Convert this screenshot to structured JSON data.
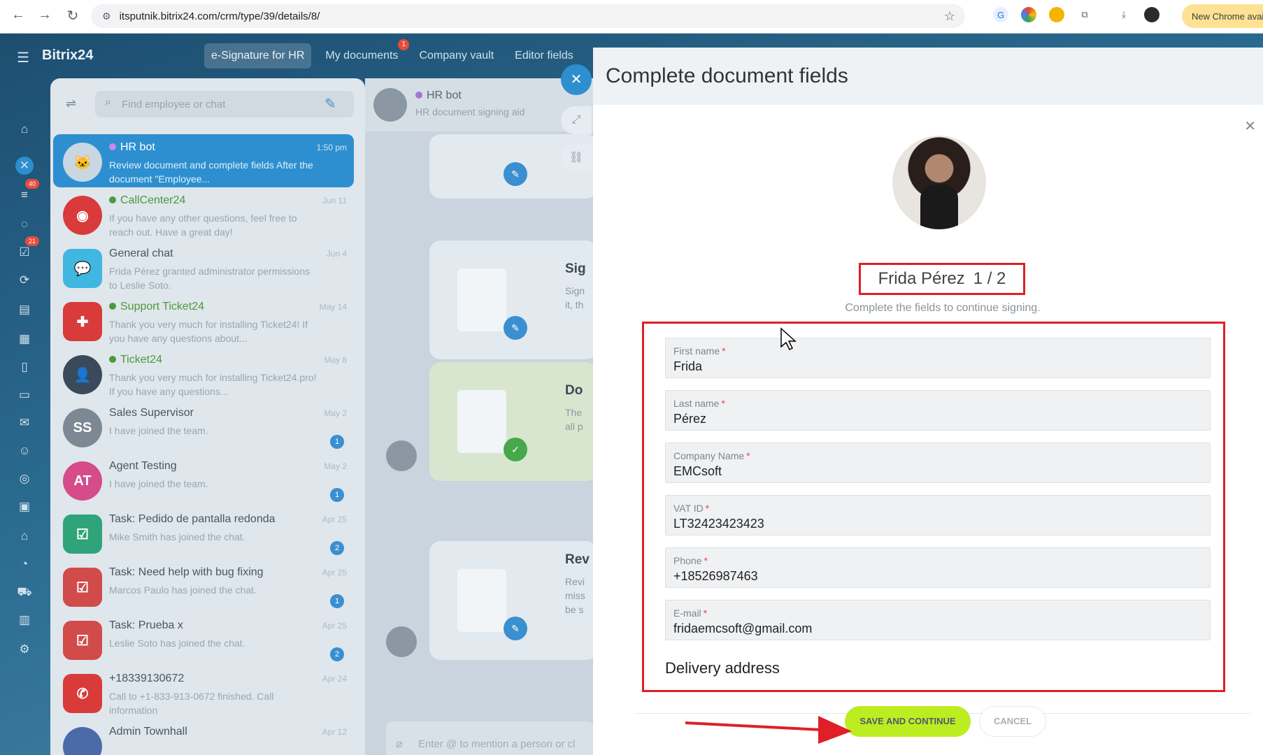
{
  "browser": {
    "url": "itsputnik.bitrix24.com/crm/type/39/details/8/",
    "new_chrome": "New Chrome avai"
  },
  "app": {
    "logo": "Bitrix24",
    "tabs": [
      {
        "label": "e-Signature for HR"
      },
      {
        "label": "My documents",
        "badge": "1"
      },
      {
        "label": "Company vault"
      },
      {
        "label": "Editor fields"
      }
    ],
    "rail_badges": [
      "40",
      "21"
    ]
  },
  "chat": {
    "search_placeholder": "Find employee or chat",
    "items": [
      {
        "name": "HR bot",
        "sub": "Review document and complete fields After the document \"Employee...",
        "date": "1:50 pm"
      },
      {
        "name": "CallCenter24",
        "sub": "If you have any other questions, feel free to reach out. Have a great day!",
        "date": "Jun 11"
      },
      {
        "name": "General chat",
        "sub": "Frida Pérez granted administrator permissions to Leslie Soto.",
        "date": "Jun 4"
      },
      {
        "name": "Support Ticket24",
        "sub": "Thank you very much for installing Ticket24! If you have any questions about...",
        "date": "May 14"
      },
      {
        "name": "Ticket24",
        "sub": "Thank you very much for installing Ticket24.pro! If you have any questions...",
        "date": "May 8"
      },
      {
        "name": "Sales Supervisor",
        "sub": "I have joined the team.",
        "date": "May 2",
        "initials": "SS",
        "count": "1"
      },
      {
        "name": "Agent Testing",
        "sub": "I have joined the team.",
        "date": "May 2",
        "initials": "AT",
        "count": "1"
      },
      {
        "name": "Task: Pedido de pantalla redonda",
        "sub": "Mike Smith has joined the chat.",
        "date": "Apr 25",
        "count": "2"
      },
      {
        "name": "Task: Need help with bug fixing",
        "sub": "Marcos Paulo has joined the chat.",
        "date": "Apr 25",
        "count": "1"
      },
      {
        "name": "Task: Prueba x",
        "sub": "Leslie Soto has joined the chat.",
        "date": "Apr 25",
        "count": "2"
      },
      {
        "name": "+18339130672",
        "sub": "Call to +1-833-913-0672 finished. Call information",
        "date": "Apr 24"
      },
      {
        "name": "Admin Townhall",
        "sub": "",
        "date": "Apr 12"
      }
    ]
  },
  "dialog": {
    "name": "HR bot",
    "subtitle": "HR document signing aid",
    "cards": [
      {
        "title": "Sig",
        "text1": "Sign",
        "text2": "it, th"
      },
      {
        "title": "Do",
        "text1": "The",
        "text2": "all p"
      },
      {
        "title": "Rev",
        "text1": "Revi",
        "text2": "miss",
        "text3": "be s"
      }
    ],
    "input_placeholder": "Enter @ to mention a person or cl"
  },
  "slider": {
    "title": "Complete document fields",
    "person_name": "Frida Pérez",
    "step": "1 / 2",
    "hint": "Complete the fields to continue signing.",
    "fields": [
      {
        "label": "First name",
        "value": "Frida"
      },
      {
        "label": "Last name",
        "value": "Pérez"
      },
      {
        "label": "Company Name",
        "value": "EMCsoft"
      },
      {
        "label": "VAT ID",
        "value": "LT32423423423"
      },
      {
        "label": "Phone",
        "value": "+18526987463"
      },
      {
        "label": "E-mail",
        "value": "fridaemcsoft@gmail.com"
      }
    ],
    "section": "Delivery address",
    "save_label": "SAVE AND CONTINUE",
    "cancel_label": "CANCEL"
  }
}
